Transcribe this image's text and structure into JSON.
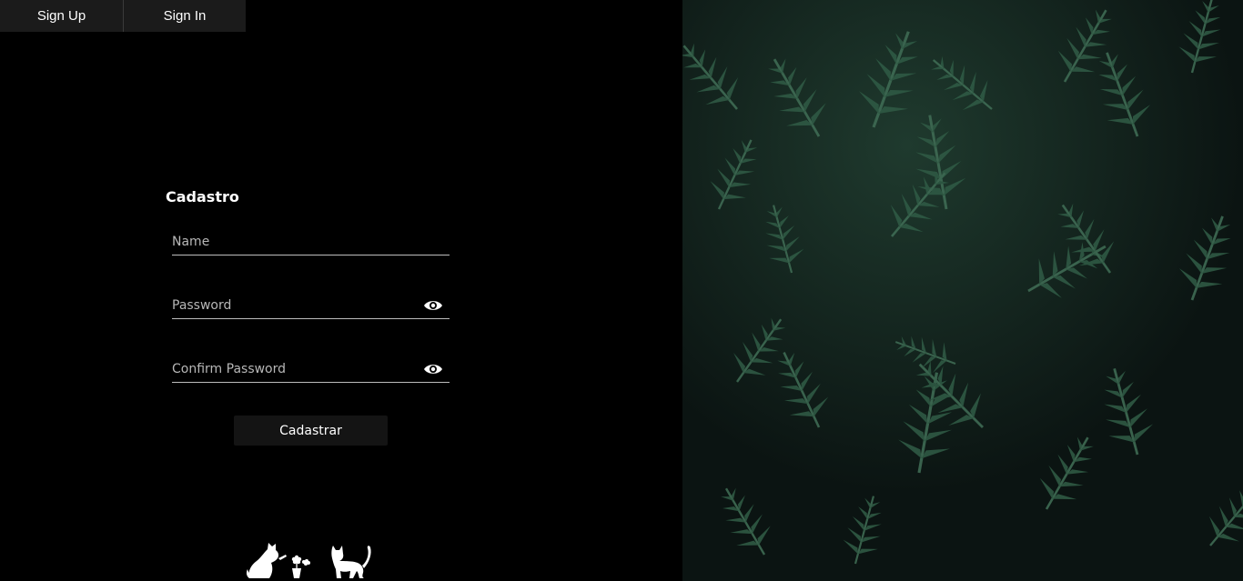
{
  "nav": {
    "tabs": [
      {
        "label": "Sign Up"
      },
      {
        "label": "Sign In"
      }
    ]
  },
  "form": {
    "title": "Cadastro",
    "name_placeholder": "Name",
    "password_placeholder": "Password",
    "confirm_placeholder": "Confirm Password",
    "submit_label": "Cadastrar"
  },
  "icons": {
    "password_toggle": "eye-icon",
    "confirm_toggle": "eye-icon",
    "illustration_left": "cat-watering-plant-icon",
    "illustration_right": "cat-icon"
  },
  "colors": {
    "background": "#000000",
    "tab_background": "#1b1b1b",
    "button_background": "#141414",
    "field_underline": "#bdbdbd",
    "foliage_dark": "#0c1614",
    "foliage_green": "#2e5540"
  }
}
